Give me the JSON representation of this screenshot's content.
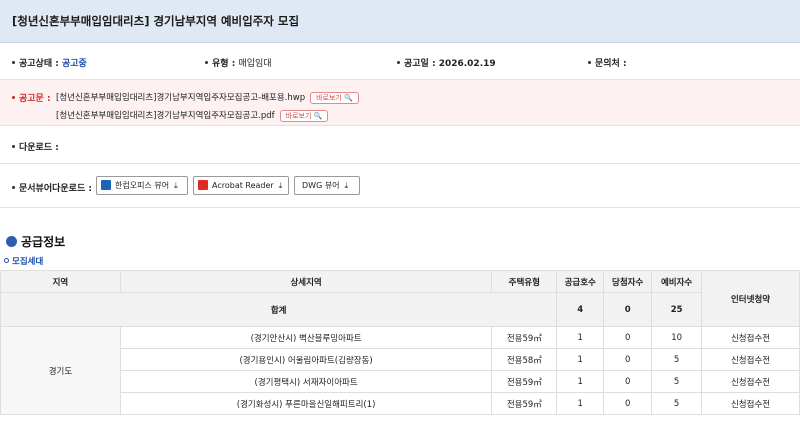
{
  "title": "[청년신혼부부매입임대리츠] 경기남부지역 예비입주자 모집",
  "info": {
    "status_label": "공고상태 : ",
    "status_value": "공고중",
    "type_label": "유형 : ",
    "type_value": "매입임대",
    "date_label": "공고일 : 2026.02.19",
    "contact_label": "문의처 :"
  },
  "notice": {
    "label": "공고문 : ",
    "files": [
      {
        "name": "[청년신혼부부매입임대리츠]경기남부지역입주자모집공고-배포용.hwp",
        "view": "바로보기 🔍"
      },
      {
        "name": "[청년신혼부부매입임대리츠]경기남부지역입주자모집공고.pdf",
        "view": "바로보기 🔍"
      }
    ]
  },
  "download_label": "다운로드 :",
  "viewer": {
    "label": "문서뷰어다운로드 :",
    "buttons": [
      {
        "label": "한컴오피스 뷰어",
        "icon": "hancom-icon"
      },
      {
        "label": "Acrobat Reader",
        "icon": "acrobat-icon"
      },
      {
        "label": "DWG 뷰어",
        "icon": "none"
      }
    ],
    "download_glyph": "⤓"
  },
  "section": {
    "title": "공급정보",
    "subtitle": "모집세대"
  },
  "table": {
    "headers": {
      "region": "지역",
      "detail": "상세지역",
      "housing_type": "주택유형",
      "supply": "공급호수",
      "winners": "당첨자수",
      "reserve": "예비자수",
      "apply": "인터넷청약"
    },
    "total": {
      "label": "합계",
      "supply": "4",
      "winners": "0",
      "reserve": "25"
    },
    "region_name": "경기도",
    "rows": [
      {
        "detail": "(경기안산시) 벽산블루밍아파트",
        "type": "전용59㎡",
        "supply": "1",
        "winners": "0",
        "reserve": "10",
        "apply": "신청접수전"
      },
      {
        "detail": "(경기용인시) 어울림아파트(김량장동)",
        "type": "전용58㎡",
        "supply": "1",
        "winners": "0",
        "reserve": "5",
        "apply": "신청접수전"
      },
      {
        "detail": "(경기평택시) 서재자이아파트",
        "type": "전용59㎡",
        "supply": "1",
        "winners": "0",
        "reserve": "5",
        "apply": "신청접수전"
      },
      {
        "detail": "(경기화성시) 푸른마을신일해피트리(1)",
        "type": "전용59㎡",
        "supply": "1",
        "winners": "0",
        "reserve": "5",
        "apply": "신청접수전"
      }
    ]
  },
  "colors": {
    "title_bg": "#dfe8f5",
    "accent_blue": "#1f4fa8",
    "accent_red": "#d12a2a",
    "notice_bg": "#fdf1f1"
  }
}
